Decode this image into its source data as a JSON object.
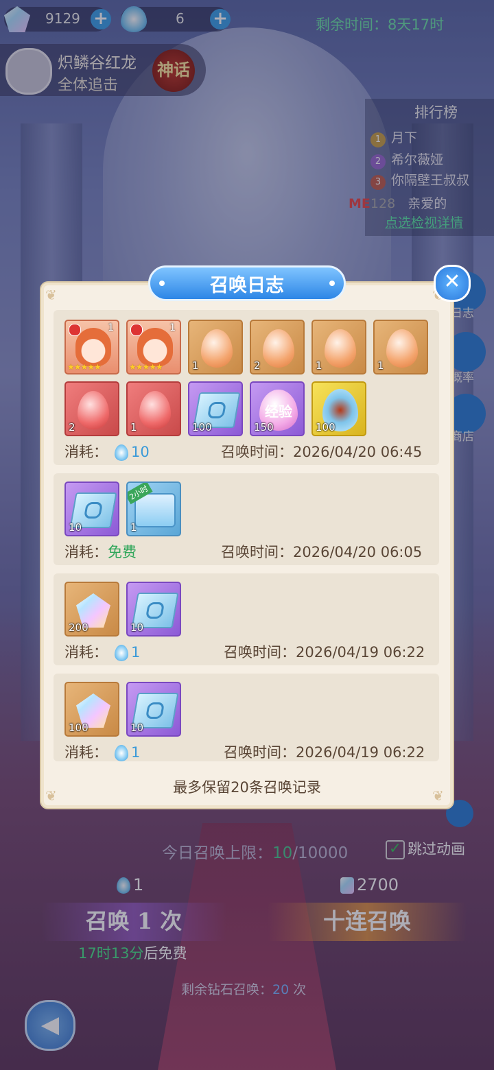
{
  "topbar": {
    "crystal_count": "9129",
    "egg_count": "6",
    "timer": "剩余时间：8天17时"
  },
  "boss": {
    "name": "炽鳞谷红龙",
    "subtitle": "全体追击",
    "rarity": "神话"
  },
  "ranking": {
    "title": "排行榜",
    "entries": [
      {
        "rank": "1",
        "name": "月下",
        "color": "#c9a24a"
      },
      {
        "rank": "2",
        "name": "希尔薇娅",
        "color": "#9a6ad0"
      },
      {
        "rank": "3",
        "name": "你隔壁王叔叔",
        "color": "#c06050"
      }
    ],
    "me_label": "ME",
    "me_rank": "128",
    "me_name": "亲爱的",
    "detail_link": "点选检视详情"
  },
  "side": {
    "log": "日志",
    "rate": "概率",
    "shop": "商店"
  },
  "dialog": {
    "title": "召唤日志",
    "footer": "最多保留20条召唤记录",
    "records": [
      {
        "cost_label": "消耗：",
        "cost_value": "10",
        "time_label": "召唤时间：",
        "time": "2026/04/20 06:45",
        "items": [
          {
            "type": "hero",
            "count": "1"
          },
          {
            "type": "hero",
            "count": "1"
          },
          {
            "type": "orange-egg",
            "count": "1"
          },
          {
            "type": "orange-egg",
            "count": "2"
          },
          {
            "type": "orange-egg",
            "count": "1"
          },
          {
            "type": "orange-egg",
            "count": "1"
          },
          {
            "type": "red-egg",
            "count": "2"
          },
          {
            "type": "red-egg",
            "count": "1"
          },
          {
            "type": "book",
            "count": "100"
          },
          {
            "type": "exp-egg",
            "count": "150",
            "label": "经验"
          },
          {
            "type": "dragon-egg",
            "count": "100"
          }
        ]
      },
      {
        "cost_label": "消耗：",
        "cost_value": "免费",
        "time_label": "召唤时间：",
        "time": "2026/04/20 06:05",
        "items": [
          {
            "type": "book",
            "count": "10"
          },
          {
            "type": "chest",
            "count": "1",
            "badge": "2小时"
          }
        ]
      },
      {
        "cost_label": "消耗：",
        "cost_value": "1",
        "time_label": "召唤时间：",
        "time": "2026/04/19 06:22",
        "items": [
          {
            "type": "crystal",
            "count": "200"
          },
          {
            "type": "book",
            "count": "10"
          }
        ]
      },
      {
        "cost_label": "消耗：",
        "cost_value": "1",
        "time_label": "召唤时间：",
        "time": "2026/04/19 06:22",
        "items": [
          {
            "type": "crystal",
            "count": "100"
          },
          {
            "type": "book",
            "count": "10"
          }
        ]
      }
    ]
  },
  "bottom": {
    "limit_label": "今日召唤上限：",
    "limit_used": "10",
    "limit_total": "/10000",
    "skip_label": "跳过动画",
    "single_cost": "1",
    "ten_cost": "2700",
    "single_btn": "召唤 1 次",
    "ten_btn": "十连召唤",
    "free_time": "17时13分",
    "free_suffix": "后免费",
    "remain_label": "剩余钻石召唤：",
    "remain_value": "20",
    "remain_suffix": " 次"
  }
}
